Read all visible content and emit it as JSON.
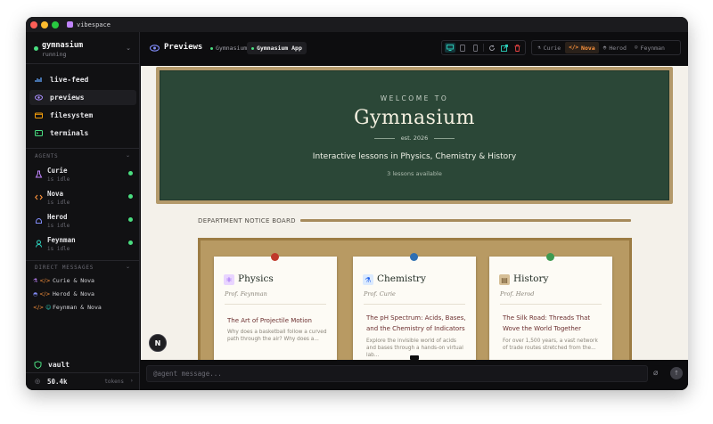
{
  "window": {
    "title": "vibespace"
  },
  "workspace": {
    "name": "gymnasium",
    "status": "running"
  },
  "nav": [
    {
      "label": "live-feed",
      "icon": "signal-icon"
    },
    {
      "label": "previews",
      "icon": "eye-icon",
      "active": true
    },
    {
      "label": "filesystem",
      "icon": "folder-icon"
    },
    {
      "label": "terminals",
      "icon": "terminal-icon"
    }
  ],
  "agents_header": "AGENTS",
  "agents": [
    {
      "name": "Curie",
      "status": "is idle",
      "color": "#c084fc",
      "icon": "flask-icon"
    },
    {
      "name": "Nova",
      "status": "is idle",
      "color": "#fb923c",
      "icon": "code-icon"
    },
    {
      "name": "Herod",
      "status": "is idle",
      "color": "#818cf8",
      "icon": "helmet-icon"
    },
    {
      "name": "Feynman",
      "status": "is idle",
      "color": "#2dd4bf",
      "icon": "person-icon"
    }
  ],
  "dm_header": "DIRECT MESSAGES",
  "dms": [
    {
      "label": "Curie & Nova"
    },
    {
      "label": "Herod & Nova"
    },
    {
      "label": "Feynman & Nova"
    }
  ],
  "vault": {
    "label": "vault"
  },
  "tokens": {
    "value": "50.4k",
    "label": "tokens"
  },
  "topbar": {
    "title": "Previews",
    "crumbs": [
      "Gymnasium",
      "Gymnasium App"
    ],
    "agent_tabs": [
      "Curie",
      "Nova",
      "Herod",
      "Feynman"
    ],
    "active_agent": "Nova"
  },
  "preview": {
    "welcome": "WELCOME TO",
    "title": "Gymnasium",
    "est": "est. 2026",
    "tagline": "Interactive lessons in Physics, Chemistry & History",
    "lessons": "3 lessons available",
    "dept_label": "DEPARTMENT NOTICE BOARD",
    "cards": [
      {
        "title": "Physics",
        "prof": "Prof. Feynman",
        "lesson": "The Art of Projectile Motion",
        "desc": "Why does a basketball follow a curved path through the air? Why does a...",
        "pin": "#c0392b",
        "icon": "atom-icon"
      },
      {
        "title": "Chemistry",
        "prof": "Prof. Curie",
        "lesson": "The pH Spectrum: Acids, Bases, and the Chemistry of Indicators",
        "desc": "Explore the invisible world of acids and bases through a hands-on virtual lab...",
        "pin": "#2e6fb3",
        "icon": "flask-icon"
      },
      {
        "title": "History",
        "prof": "Prof. Herod",
        "lesson": "The Silk Road: Threads That Wove the World Together",
        "desc": "For over 1,500 years, a vast network of trade routes stretched from the...",
        "pin": "#3e9a50",
        "icon": "scroll-icon"
      }
    ],
    "fab": "N"
  },
  "input": {
    "placeholder": "@agent message..."
  }
}
